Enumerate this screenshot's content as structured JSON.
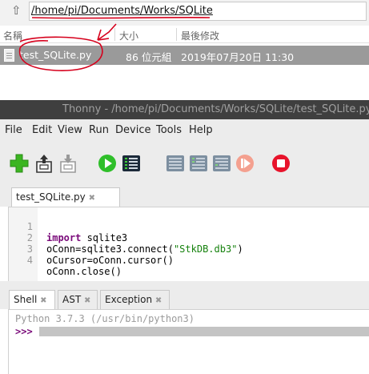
{
  "file_manager": {
    "path": "/home/pi/Documents/Works/SQLite",
    "columns": [
      "名稱",
      "大小",
      "最後修改"
    ],
    "rows": [
      {
        "name": "test_SQLite.py",
        "size": "86 位元組",
        "modified": "2019年07月20日 11:30"
      }
    ]
  },
  "thonny": {
    "title": "Thonny  -  /home/pi/Documents/Works/SQLite/test_SQLite.py",
    "menu": [
      "File",
      "Edit",
      "View",
      "Run",
      "Device",
      "Tools",
      "Help"
    ],
    "toolbar": [
      "new",
      "load",
      "save",
      "run",
      "debug",
      "step-over",
      "step-into",
      "step-out",
      "resume",
      "stop"
    ],
    "editor_tab": "test_SQLite.py",
    "code": [
      {
        "n": "1",
        "kw": "import",
        "rest": " sqlite3"
      },
      {
        "n": "2",
        "pre": "oConn=sqlite3.connect(",
        "str": "\"StkDB.db3\"",
        "post": ")"
      },
      {
        "n": "3",
        "text": "oCursor=oConn.cursor()"
      },
      {
        "n": "4",
        "text": "oConn.close()"
      }
    ],
    "bottom_tabs": [
      "Shell",
      "AST",
      "Exception"
    ],
    "shell": {
      "banner": "Python 3.7.3 (/usr/bin/python3)",
      "prompt": ">>>"
    }
  },
  "colors": {
    "selected_row": "#9a9a9a",
    "titlebar": "#3f3f3f",
    "keyword": "#7a0a7a",
    "string": "#16820e",
    "annotation": "#d6001c"
  }
}
